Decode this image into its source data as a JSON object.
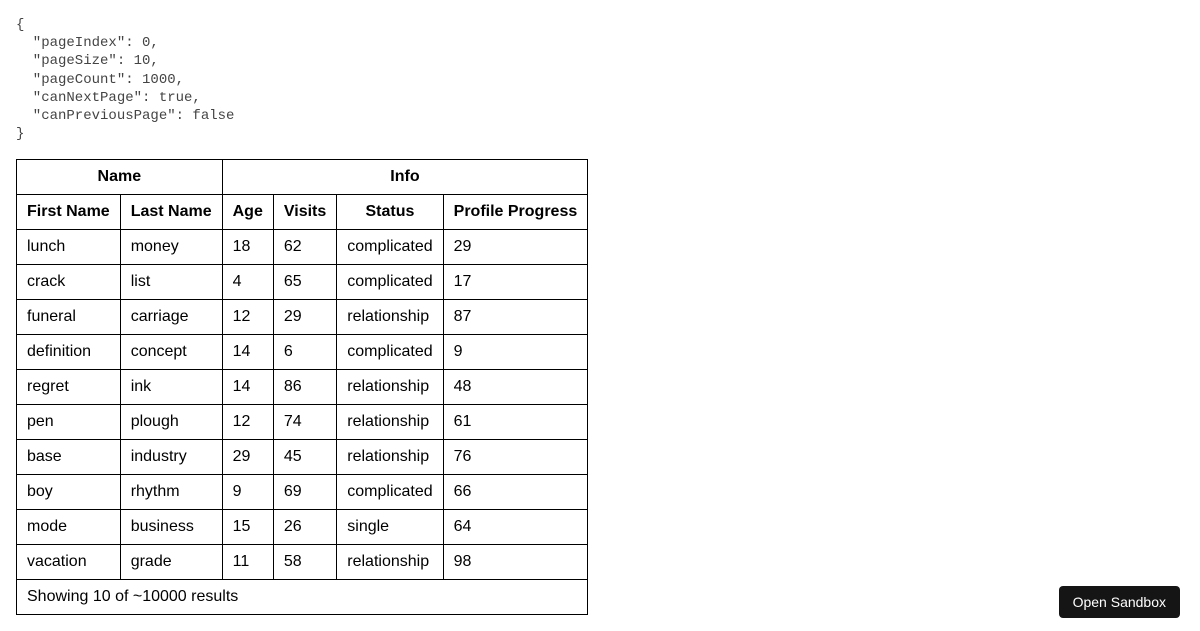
{
  "debug": {
    "pageIndex": 0,
    "pageSize": 10,
    "pageCount": 1000,
    "canNextPage": true,
    "canPreviousPage": false
  },
  "table": {
    "groupHeaders": {
      "name": "Name",
      "info": "Info"
    },
    "columns": {
      "firstName": "First Name",
      "lastName": "Last Name",
      "age": "Age",
      "visits": "Visits",
      "status": "Status",
      "profileProgress": "Profile Progress"
    },
    "rows": [
      {
        "firstName": "lunch",
        "lastName": "money",
        "age": "18",
        "visits": "62",
        "status": "complicated",
        "profileProgress": "29"
      },
      {
        "firstName": "crack",
        "lastName": "list",
        "age": "4",
        "visits": "65",
        "status": "complicated",
        "profileProgress": "17"
      },
      {
        "firstName": "funeral",
        "lastName": "carriage",
        "age": "12",
        "visits": "29",
        "status": "relationship",
        "profileProgress": "87"
      },
      {
        "firstName": "definition",
        "lastName": "concept",
        "age": "14",
        "visits": "6",
        "status": "complicated",
        "profileProgress": "9"
      },
      {
        "firstName": "regret",
        "lastName": "ink",
        "age": "14",
        "visits": "86",
        "status": "relationship",
        "profileProgress": "48"
      },
      {
        "firstName": "pen",
        "lastName": "plough",
        "age": "12",
        "visits": "74",
        "status": "relationship",
        "profileProgress": "61"
      },
      {
        "firstName": "base",
        "lastName": "industry",
        "age": "29",
        "visits": "45",
        "status": "relationship",
        "profileProgress": "76"
      },
      {
        "firstName": "boy",
        "lastName": "rhythm",
        "age": "9",
        "visits": "69",
        "status": "complicated",
        "profileProgress": "66"
      },
      {
        "firstName": "mode",
        "lastName": "business",
        "age": "15",
        "visits": "26",
        "status": "single",
        "profileProgress": "64"
      },
      {
        "firstName": "vacation",
        "lastName": "grade",
        "age": "11",
        "visits": "58",
        "status": "relationship",
        "profileProgress": "98"
      }
    ],
    "footer": "Showing 10 of ~10000 results"
  },
  "openSandbox": {
    "label": "Open Sandbox"
  }
}
